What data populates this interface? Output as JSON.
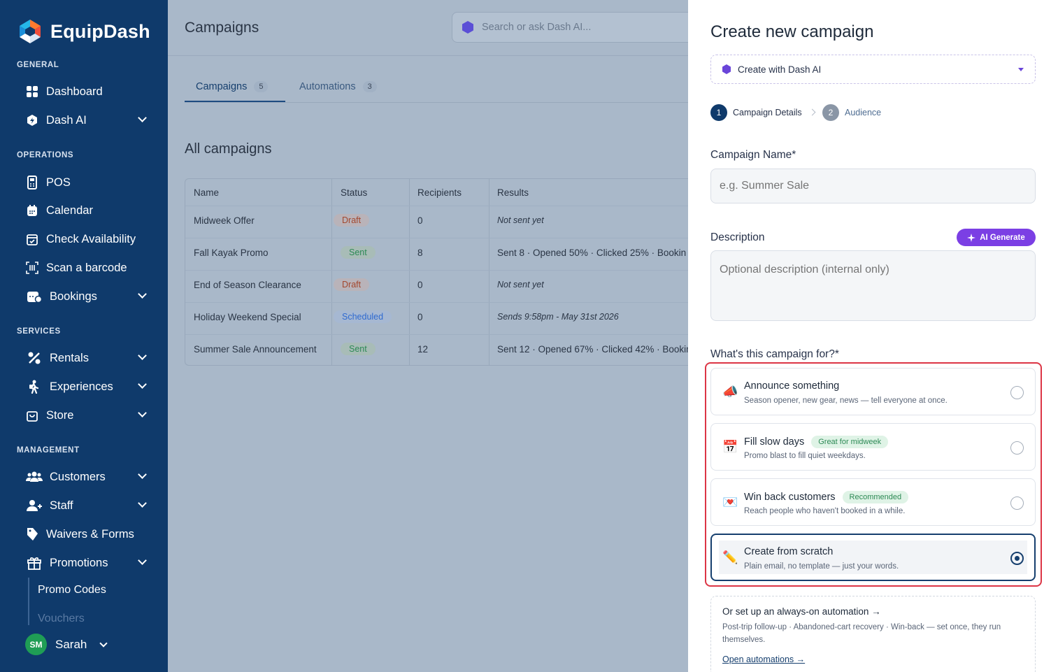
{
  "sidebar": {
    "logo_text": "EquipDash",
    "sections": {
      "general": "GENERAL",
      "operations": "OPERATIONS",
      "services": "SERVICES",
      "management": "MANAGEMENT"
    },
    "items": {
      "dashboard": "Dashboard",
      "dash_ai": "Dash AI",
      "pos": "POS",
      "calendar": "Calendar",
      "check_availability": "Check Availability",
      "scan_barcode": "Scan a barcode",
      "bookings": "Bookings",
      "rentals": "Rentals",
      "experiences": "Experiences",
      "store": "Store",
      "customers": "Customers",
      "staff": "Staff",
      "waivers": "Waivers & Forms",
      "promotions": "Promotions",
      "promo_codes": "Promo Codes",
      "vouchers": "Vouchers"
    },
    "user": {
      "initials": "SM",
      "name": "Sarah"
    }
  },
  "main": {
    "title": "Campaigns",
    "search_placeholder": "Search or ask Dash AI...",
    "tabs": [
      {
        "label": "Campaigns",
        "count": "5"
      },
      {
        "label": "Automations",
        "count": "3"
      }
    ],
    "section_title": "All campaigns",
    "table": {
      "headers": [
        "Name",
        "Status",
        "Recipients",
        "Results"
      ],
      "rows": [
        {
          "name": "Midweek Offer",
          "status": "Draft",
          "recipients": "0",
          "results": "Not sent yet"
        },
        {
          "name": "Fall Kayak Promo",
          "status": "Sent",
          "recipients": "8",
          "results": "Sent 8 · Opened 50% · Clicked 25% · Bookin"
        },
        {
          "name": "End of Season Clearance",
          "status": "Draft",
          "recipients": "0",
          "results": "Not sent yet"
        },
        {
          "name": "Holiday Weekend Special",
          "status": "Scheduled",
          "recipients": "0",
          "results": "Sends 9:58pm - May 31st 2026"
        },
        {
          "name": "Summer Sale Announcement",
          "status": "Sent",
          "recipients": "12",
          "results": "Sent 12 · Opened 67% · Clicked 42% · Bookin"
        }
      ]
    }
  },
  "drawer": {
    "title": "Create new campaign",
    "ai_select": "Create with Dash AI",
    "steps": [
      {
        "num": "1",
        "label": "Campaign Details"
      },
      {
        "num": "2",
        "label": "Audience"
      }
    ],
    "name_label": "Campaign Name*",
    "name_placeholder": "e.g. Summer Sale",
    "desc_label": "Description",
    "ai_generate": "AI Generate",
    "desc_placeholder": "Optional description (internal only)",
    "purpose_label": "What's this campaign for?*",
    "options": [
      {
        "title": "Announce something",
        "desc": "Season opener, new gear, news — tell everyone at once.",
        "tag": "",
        "emoji": "📣"
      },
      {
        "title": "Fill slow days",
        "desc": "Promo blast to fill quiet weekdays.",
        "tag": "Great for midweek",
        "emoji": "📅"
      },
      {
        "title": "Win back customers",
        "desc": "Reach people who haven't booked in a while.",
        "tag": "Recommended",
        "emoji": "💌"
      },
      {
        "title": "Create from scratch",
        "desc": "Plain email, no template — just your words.",
        "tag": "",
        "emoji": "✏️"
      }
    ],
    "automation": {
      "title": "Or set up an always-on automation →",
      "desc": "Post-trip follow-up · Abandoned-cart recovery · Win-back — set once, they run themselves.",
      "link": "Open automations →"
    }
  },
  "colors": {
    "sidebar": "#0f3a6b",
    "primary": "#163f6e",
    "ai_purple": "#7b3fe4",
    "highlight": "#dc3545"
  }
}
